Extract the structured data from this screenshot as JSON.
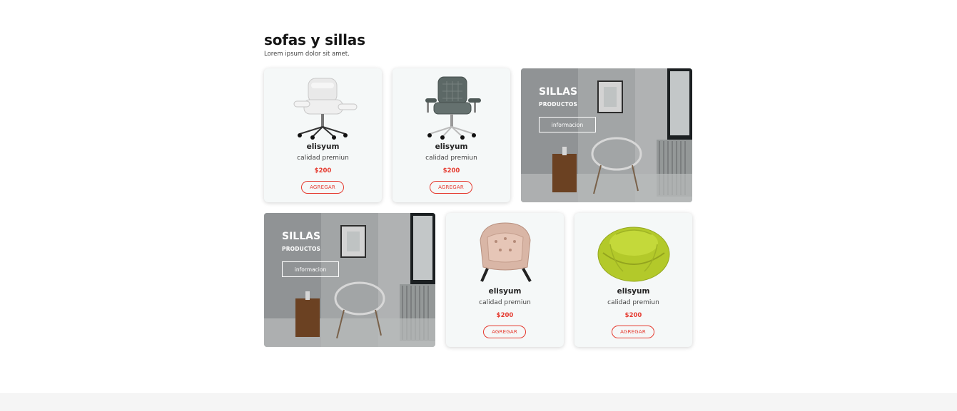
{
  "section": {
    "title": "sofas y sillas",
    "subtitle": "Lorem ipsum dolor sit amet."
  },
  "products": [
    {
      "name": "elisyum",
      "desc": "calidad premiun",
      "price": "$200",
      "button": "AGREGAR",
      "image": "white-office-chair"
    },
    {
      "name": "elisyum",
      "desc": "calidad premiun",
      "price": "$200",
      "button": "AGREGAR",
      "image": "gray-office-chair"
    },
    {
      "name": "elisyum",
      "desc": "calidad premiun",
      "price": "$200",
      "button": "AGREGAR",
      "image": "pink-lounge-chair"
    },
    {
      "name": "elisyum",
      "desc": "calidad premiun",
      "price": "$200",
      "button": "AGREGAR",
      "image": "green-bean-bag-chair"
    }
  ],
  "banners": [
    {
      "title": "SILLAS",
      "subtitle": "PRODUCTOS",
      "button": "informacion",
      "image": "room-with-wire-chair"
    },
    {
      "title": "SILLAS",
      "subtitle": "PRODUCTOS",
      "button": "informacion",
      "image": "room-with-wire-chair"
    }
  ],
  "colors": {
    "accent": "#e53a2f",
    "card_bg": "#f5f8f8",
    "footer_bg": "#f5f5f5"
  }
}
